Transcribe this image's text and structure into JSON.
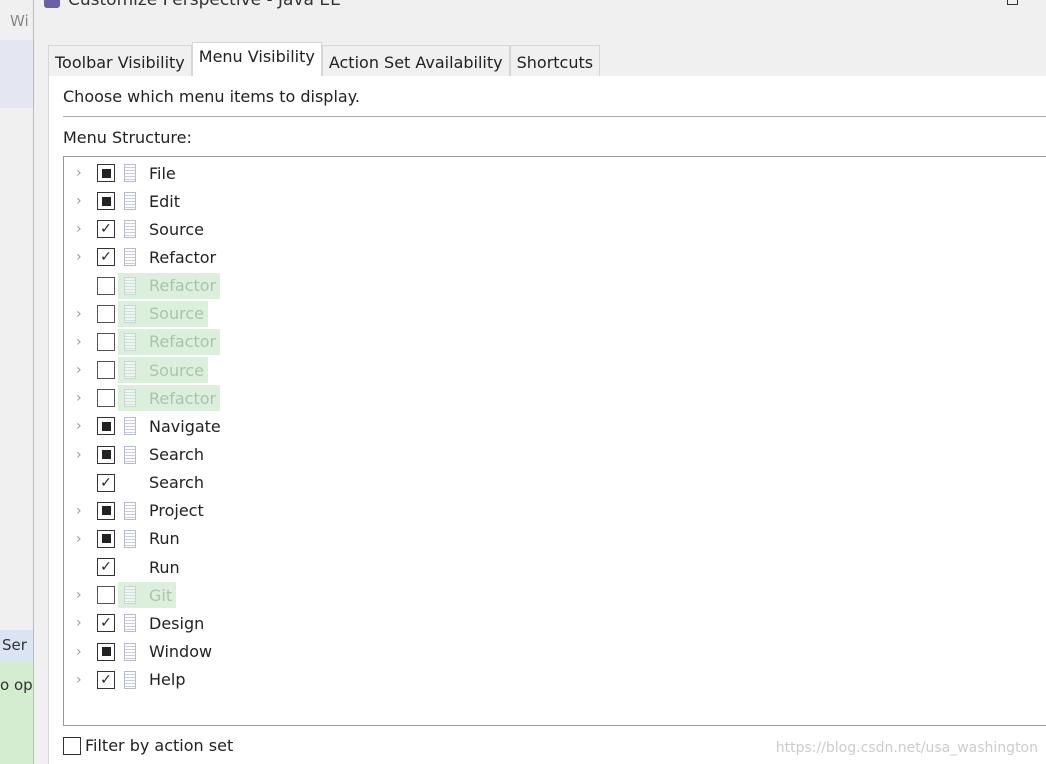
{
  "background": {
    "menu_fragment": "Wi",
    "view_tab_fragment": "Ser",
    "status_fragment": "o op"
  },
  "dialog": {
    "title": "Customize Perspective - Java EE"
  },
  "tabs": [
    {
      "label": "Toolbar Visibility",
      "active": false
    },
    {
      "label": "Menu Visibility",
      "active": true
    },
    {
      "label": "Action Set Availability",
      "active": false
    },
    {
      "label": "Shortcuts",
      "active": false
    }
  ],
  "description": "Choose which menu items to display.",
  "menu_structure_label": "Menu Structure:",
  "tree": [
    {
      "label": "File",
      "expandable": true,
      "state": "partial",
      "icon": true,
      "disabled": false
    },
    {
      "label": "Edit",
      "expandable": true,
      "state": "partial",
      "icon": true,
      "disabled": false
    },
    {
      "label": "Source",
      "expandable": true,
      "state": "checked",
      "icon": true,
      "disabled": false
    },
    {
      "label": "Refactor",
      "expandable": true,
      "state": "checked",
      "icon": true,
      "disabled": false
    },
    {
      "label": "Refactor",
      "expandable": false,
      "state": "unchecked",
      "icon": true,
      "disabled": true
    },
    {
      "label": "Source",
      "expandable": true,
      "state": "unchecked",
      "icon": true,
      "disabled": true
    },
    {
      "label": "Refactor",
      "expandable": true,
      "state": "unchecked",
      "icon": true,
      "disabled": true
    },
    {
      "label": "Source",
      "expandable": true,
      "state": "unchecked",
      "icon": true,
      "disabled": true
    },
    {
      "label": "Refactor",
      "expandable": true,
      "state": "unchecked",
      "icon": true,
      "disabled": true
    },
    {
      "label": "Navigate",
      "expandable": true,
      "state": "partial",
      "icon": true,
      "disabled": false
    },
    {
      "label": "Search",
      "expandable": true,
      "state": "partial",
      "icon": true,
      "disabled": false
    },
    {
      "label": "Search",
      "expandable": false,
      "state": "checked",
      "icon": false,
      "disabled": false
    },
    {
      "label": "Project",
      "expandable": true,
      "state": "partial",
      "icon": true,
      "disabled": false
    },
    {
      "label": "Run",
      "expandable": true,
      "state": "partial",
      "icon": true,
      "disabled": false
    },
    {
      "label": "Run",
      "expandable": false,
      "state": "checked",
      "icon": false,
      "disabled": false
    },
    {
      "label": "Git",
      "expandable": true,
      "state": "unchecked",
      "icon": true,
      "disabled": true
    },
    {
      "label": "Design",
      "expandable": true,
      "state": "checked",
      "icon": true,
      "disabled": false
    },
    {
      "label": "Window",
      "expandable": true,
      "state": "partial",
      "icon": true,
      "disabled": false
    },
    {
      "label": "Help",
      "expandable": true,
      "state": "checked",
      "icon": true,
      "disabled": false
    }
  ],
  "filter": {
    "label": "Filter by action set",
    "checked": false
  },
  "watermark": "https://blog.csdn.net/usa_washington"
}
